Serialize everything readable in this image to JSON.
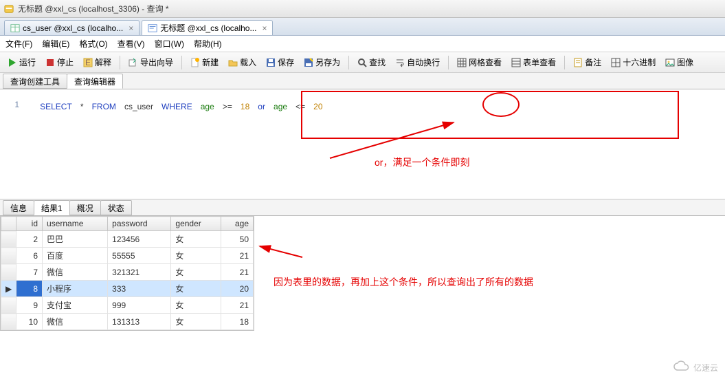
{
  "window": {
    "title": "无标题 @xxl_cs (localhost_3306) - 查询 *"
  },
  "doc_tabs": [
    {
      "label": "cs_user @xxl_cs (localho...",
      "active": false
    },
    {
      "label": "无标题 @xxl_cs (localho...",
      "active": true
    }
  ],
  "menus": {
    "file": "文件(F)",
    "edit": "编辑(E)",
    "format": "格式(O)",
    "view": "查看(V)",
    "window": "窗口(W)",
    "help": "帮助(H)"
  },
  "toolbar": {
    "run": "运行",
    "stop": "停止",
    "explain": "解释",
    "export_wizard": "导出向导",
    "new": "新建",
    "open": "载入",
    "save": "保存",
    "save_as": "另存为",
    "find": "查找",
    "wrap": "自动换行",
    "grid_view": "网格查看",
    "form_view": "表单查看",
    "memo": "备注",
    "hex": "十六进制",
    "image": "图像"
  },
  "sub_tabs": {
    "builder": "查询创建工具",
    "editor": "查询编辑器"
  },
  "sql": {
    "line_no": "1",
    "select": "SELECT",
    "star": "*",
    "from": "FROM",
    "tbl": "cs_user",
    "where": "WHERE",
    "c1": "age",
    "op1": ">=",
    "v1": "18",
    "or": "or",
    "c2": "age",
    "op2": "<=",
    "v2": "20"
  },
  "annot": {
    "text1": "or，满足一个条件即刻",
    "text2": "因为表里的数据，再加上这个条件，所以查询出了所有的数据"
  },
  "result_tabs": {
    "info": "信息",
    "result": "结果1",
    "profile": "概况",
    "status": "状态"
  },
  "columns": {
    "id": "id",
    "username": "username",
    "password": "password",
    "gender": "gender",
    "age": "age"
  },
  "rows": [
    {
      "id": "2",
      "username": "巴巴",
      "password": "123456",
      "gender": "女",
      "age": "50"
    },
    {
      "id": "6",
      "username": "百度",
      "password": "55555",
      "gender": "女",
      "age": "21"
    },
    {
      "id": "7",
      "username": "微信",
      "password": "321321",
      "gender": "女",
      "age": "21"
    },
    {
      "id": "8",
      "username": "小程序",
      "password": "333",
      "gender": "女",
      "age": "20"
    },
    {
      "id": "9",
      "username": "支付宝",
      "password": "999",
      "gender": "女",
      "age": "21"
    },
    {
      "id": "10",
      "username": "微信",
      "password": "131313",
      "gender": "女",
      "age": "18"
    }
  ],
  "watermark": "亿速云"
}
